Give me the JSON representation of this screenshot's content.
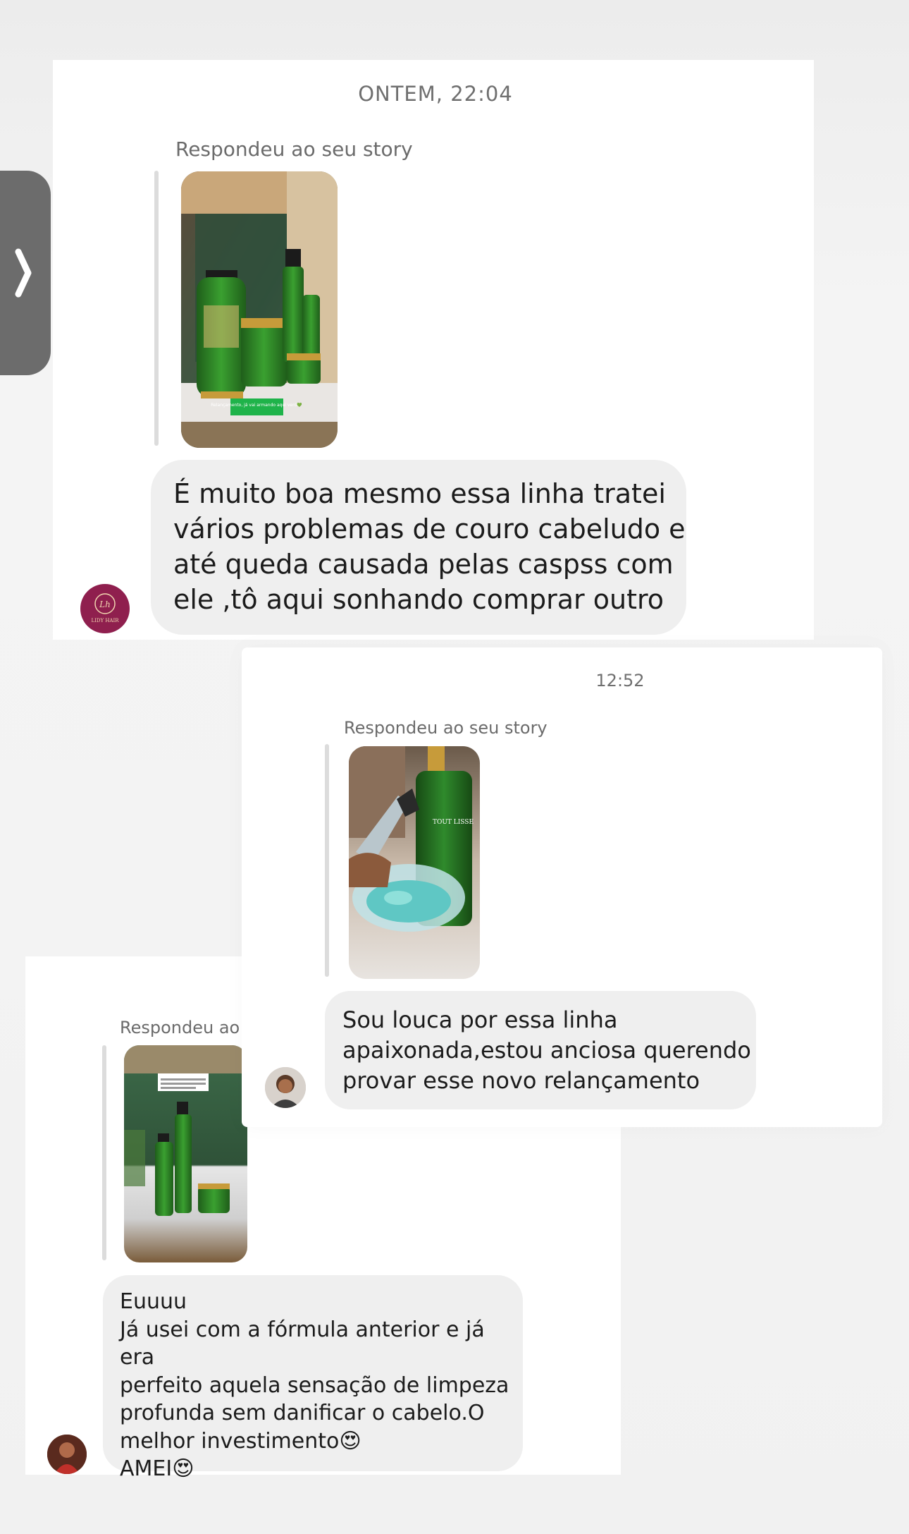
{
  "thread1": {
    "timestamp": "ONTEM, 22:04",
    "reply_label": "Respondeu ao seu story",
    "story_caption": "Relançamento, já vai armando aqui verd💚",
    "message_lines": [
      "É muito boa mesmo essa linha tratei",
      "vários problemas de couro cabeludo e",
      "até queda causada pelas caspss com",
      "ele ,tô aqui sonhando comprar outro"
    ],
    "avatar_label": "LIDY HAIR"
  },
  "thread2": {
    "timestamp": "12:52",
    "reply_label": "Respondeu ao seu story",
    "product_label": "TOUT LISSE",
    "message_lines": [
      "Sou louca por essa linha",
      "apaixonada,estou anciosa querendo",
      "provar esse novo relançamento"
    ]
  },
  "thread3": {
    "reply_label": "Respondeu ao seu story",
    "message_lines": [
      "Euuuu",
      "Já usei com a fórmula anterior e já era",
      "perfeito aquela sensação de limpeza",
      "profunda sem danificar o cabelo.O",
      "melhor investimento😍",
      "AMEI😍"
    ]
  },
  "side_handle": {
    "icon": "chevron-right-icon"
  },
  "colors": {
    "background": "#f2f2f2",
    "card": "#ffffff",
    "bubble": "#efefef",
    "text": "#1b1b1b",
    "muted": "#6f6f6f",
    "product_green": "#2f8a2c"
  }
}
